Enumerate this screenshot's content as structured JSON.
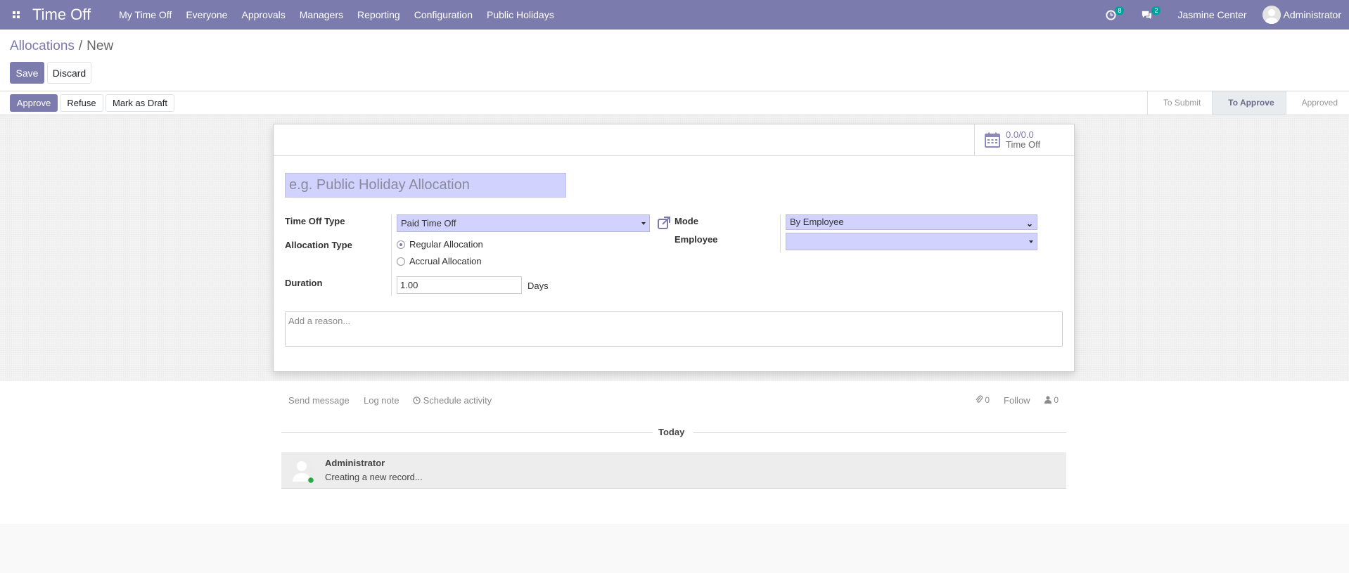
{
  "navbar": {
    "app_title": "Time Off",
    "menu": [
      "My Time Off",
      "Everyone",
      "Approvals",
      "Managers",
      "Reporting",
      "Configuration",
      "Public Holidays"
    ],
    "activity_count": "8",
    "message_count": "2",
    "company": "Jasmine Center",
    "user": "Administrator"
  },
  "breadcrumb": {
    "parent": "Allocations",
    "separator": "/",
    "current": "New"
  },
  "actions": {
    "save": "Save",
    "discard": "Discard"
  },
  "statusbar": {
    "buttons": {
      "approve": "Approve",
      "refuse": "Refuse",
      "draft": "Mark as Draft"
    },
    "steps": [
      "To Submit",
      "To Approve",
      "Approved"
    ],
    "active_step": "To Approve"
  },
  "stat_button": {
    "value": "0.0/0.0",
    "label": "Time Off"
  },
  "form": {
    "name_placeholder": "e.g. Public Holiday Allocation",
    "time_off_type_label": "Time Off Type",
    "time_off_type_value": "Paid Time Off",
    "allocation_type_label": "Allocation Type",
    "allocation_options": [
      "Regular Allocation",
      "Accrual Allocation"
    ],
    "allocation_selected": "Regular Allocation",
    "duration_label": "Duration",
    "duration_value": "1.00",
    "duration_unit": "Days",
    "mode_label": "Mode",
    "mode_value": "By Employee",
    "employee_label": "Employee",
    "employee_value": "",
    "reason_placeholder": "Add a reason..."
  },
  "chatter": {
    "send_message": "Send message",
    "log_note": "Log note",
    "schedule_activity": "Schedule activity",
    "attachments_count": "0",
    "follow": "Follow",
    "followers_count": "0",
    "date_separator": "Today",
    "messages": [
      {
        "author": "Administrator",
        "body": "Creating a new record..."
      }
    ]
  },
  "colors": {
    "brand": "#7c7bad",
    "required_field": "#d2d2ff",
    "online": "#28a745",
    "badge": "#00a09d"
  }
}
